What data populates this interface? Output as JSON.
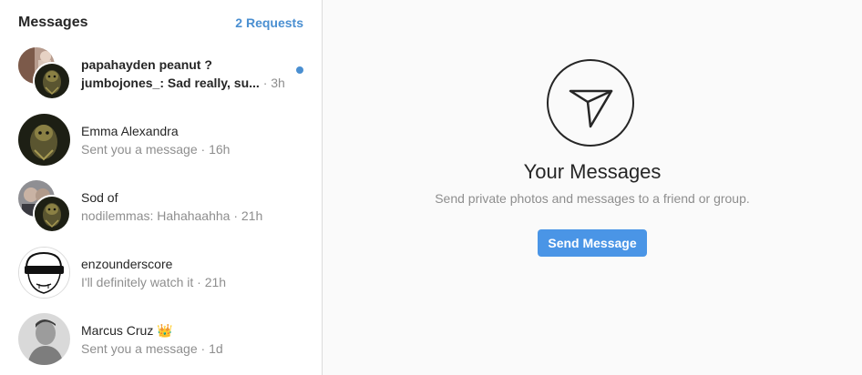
{
  "sidebar": {
    "title": "Messages",
    "requests_label": "2 Requests",
    "threads": [
      {
        "name": "papahayden peanut ?",
        "preview": "jumbojones_: Sad really, su...",
        "time": "· 3h",
        "unread": true,
        "avatar": "group-avatar"
      },
      {
        "name": "Emma Alexandra",
        "preview": "Sent you a message",
        "time": "· 16h",
        "unread": false,
        "avatar": "profile-avatar"
      },
      {
        "name": "Sod of",
        "preview": "nodilemmas: Hahahaahha",
        "time": "· 21h",
        "unread": false,
        "avatar": "group-avatar"
      },
      {
        "name": "enzounderscore",
        "preview": "I'll definitely watch it",
        "time": "· 21h",
        "unread": false,
        "avatar": "sketch-avatar"
      },
      {
        "name": "Marcus Cruz 👑",
        "preview": "Sent you a message",
        "time": "· 1d",
        "unread": false,
        "avatar": "profile-avatar"
      }
    ]
  },
  "main": {
    "icon": "paper-plane-icon",
    "title": "Your Messages",
    "subtitle": "Send private photos and messages to a friend or group.",
    "button_label": "Send Message"
  },
  "colors": {
    "accent": "#4a95e6",
    "link": "#4a8fd1",
    "unread_dot": "#4a8fd1",
    "text": "#262626",
    "muted": "#8e8e8e",
    "border": "#dbdbdb"
  }
}
